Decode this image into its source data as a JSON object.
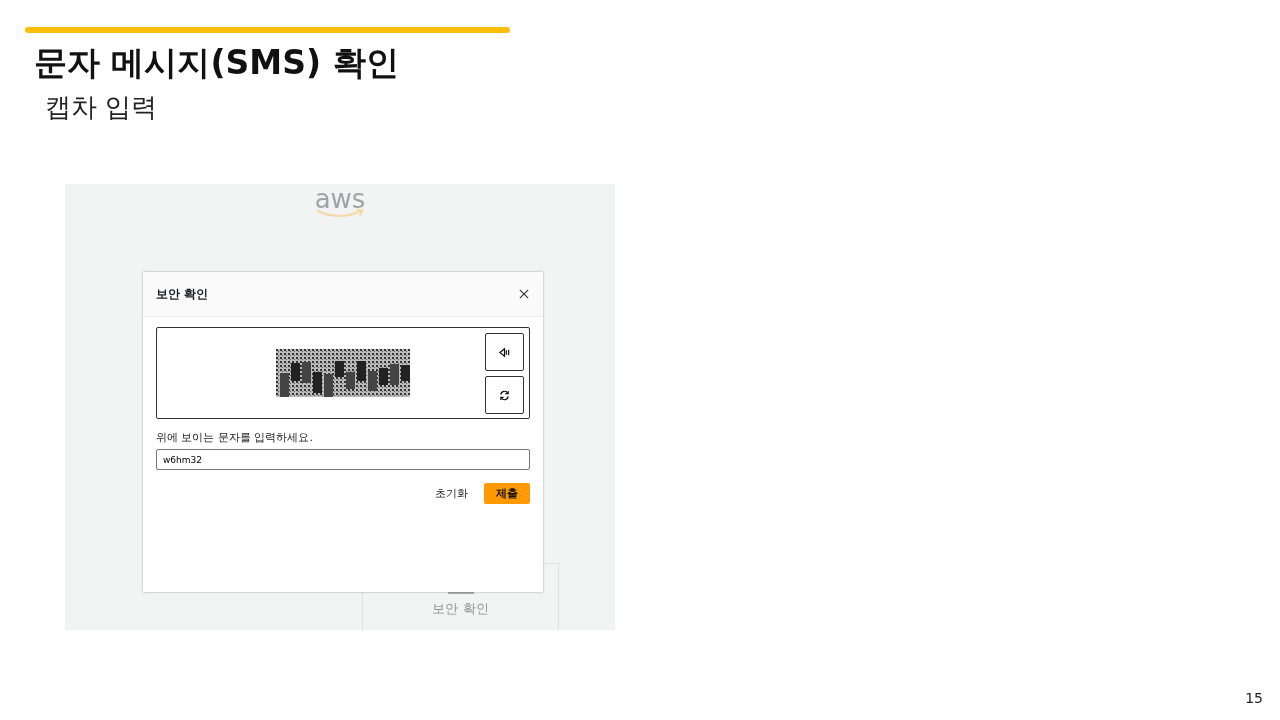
{
  "slide": {
    "title": "문자 메시지(SMS) 확인",
    "subtitle": "캡차 입력",
    "page_number": "15"
  },
  "screenshot": {
    "logo": "aws",
    "background_card": {
      "title": "보안 확인"
    },
    "dialog": {
      "title": "보안 확인",
      "prompt": "위에 보이는 문자를 입력하세요.",
      "input": {
        "value": "w6hm32"
      },
      "buttons": [
        {
          "label": "초기화",
          "kind": "link"
        },
        {
          "label": "제출",
          "kind": "primary"
        }
      ]
    }
  }
}
